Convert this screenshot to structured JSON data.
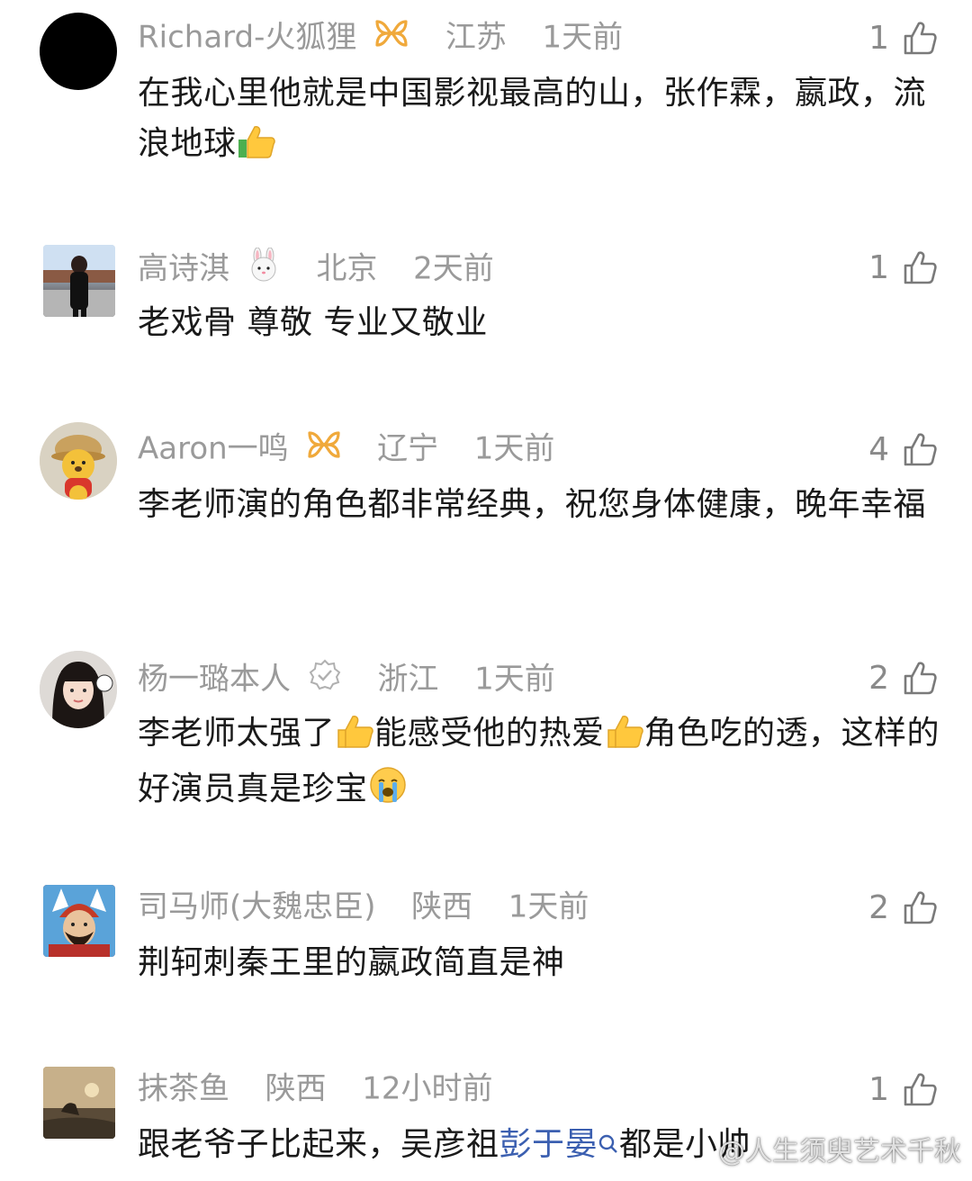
{
  "comments": [
    {
      "username": "Richard-火狐狸",
      "location": "江苏",
      "time": "1天前",
      "likes": "1",
      "text": "在我心里他就是中国影视最高的山，张作霖，嬴政，流浪地球",
      "badge_icon": "gold-ribbon-icon",
      "trailing_emoji": "thumbs-up-emoji"
    },
    {
      "username": "高诗淇",
      "location": "北京",
      "time": "2天前",
      "likes": "1",
      "text": "老戏骨 尊敬 专业又敬业",
      "badge_icon": "rabbit-emoji"
    },
    {
      "username": "Aaron一鸣",
      "location": "辽宁",
      "time": "1天前",
      "likes": "4",
      "text": "李老师演的角色都非常经典，祝您身体健康，晚年幸福",
      "badge_icon": "gold-ribbon-icon"
    },
    {
      "username": "杨一璐本人",
      "location": "浙江",
      "time": "1天前",
      "likes": "2",
      "text_parts": [
        "李老师太强了",
        "能感受他的热爱",
        "角色吃的透，这样的好演员真是珍宝"
      ],
      "badge_icon": "verified-icon"
    },
    {
      "username": "司马师(大魏忠臣)",
      "location": "陕西",
      "time": "1天前",
      "likes": "2",
      "text": "荆轲刺秦王里的嬴政简直是神"
    },
    {
      "username": "抹茶鱼",
      "location": "陕西",
      "time": "12小时前",
      "likes": "1",
      "text_before": "跟老爷子比起来，吴彦祖",
      "text_link": "彭于晏",
      "text_after": "都是小帅"
    }
  ],
  "watermark": "@人生须臾艺术千秋",
  "colors": {
    "meta": "#9a9a9a",
    "link": "#3b5fb0",
    "badge": "#f0a93b"
  }
}
